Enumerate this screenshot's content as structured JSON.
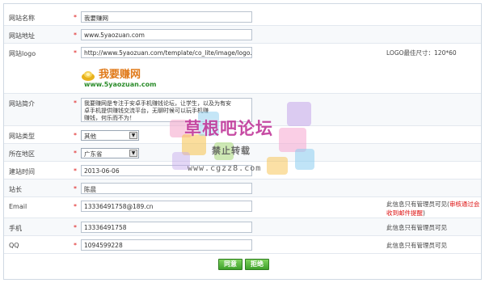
{
  "form": {
    "site_name": {
      "label": "网站名称",
      "value": "我要赚网"
    },
    "site_url": {
      "label": "网站地址",
      "value": "www.5yaozuan.com"
    },
    "site_logo": {
      "label": "网站logo",
      "value": "http://www.5yaozuan.com/template/co_lite/image/logo.pn",
      "note": "LOGO最佳尺寸：120*60"
    },
    "logo_preview": {
      "brand": "我要赚网",
      "domain": "www.5yaozuan.com"
    },
    "site_intro": {
      "label": "网站简介",
      "lines": [
        "我要赚网是专注于安卓手机赚钱论坛，让学生，以及为有安",
        "卓手机提供赚钱交流平台，无聊时候可以玩手机赚",
        "赚钱，何乐而不为！"
      ]
    },
    "site_type": {
      "label": "网站类型",
      "value": "其他"
    },
    "region": {
      "label": "所在地区",
      "value": "广东省"
    },
    "build_time": {
      "label": "建站时间",
      "value": "2013-06-06"
    },
    "owner": {
      "label": "站长",
      "value": "陈晨"
    },
    "email": {
      "label": "Email",
      "value": "13336491758@189.cn",
      "note_black": "此信息只有管理员可见(",
      "note_red": "审核通过会收到邮件提醒",
      "note_end": ")"
    },
    "phone": {
      "label": "手机",
      "value": "13336491758",
      "note": "此信息只有管理员可见"
    },
    "qq": {
      "label": "QQ",
      "value": "1094599228",
      "note": "此信息只有管理员可见"
    },
    "required_mark": "*",
    "buttons": {
      "agree": "同意",
      "reject": "拒绝"
    }
  },
  "watermark": {
    "title": "草根吧论坛",
    "subtitle": "禁止转载",
    "url": "www.cgzz8.com"
  },
  "colors": {
    "required": "#dd1111",
    "button": "#3ea12a",
    "watermark": "#c0389a"
  }
}
